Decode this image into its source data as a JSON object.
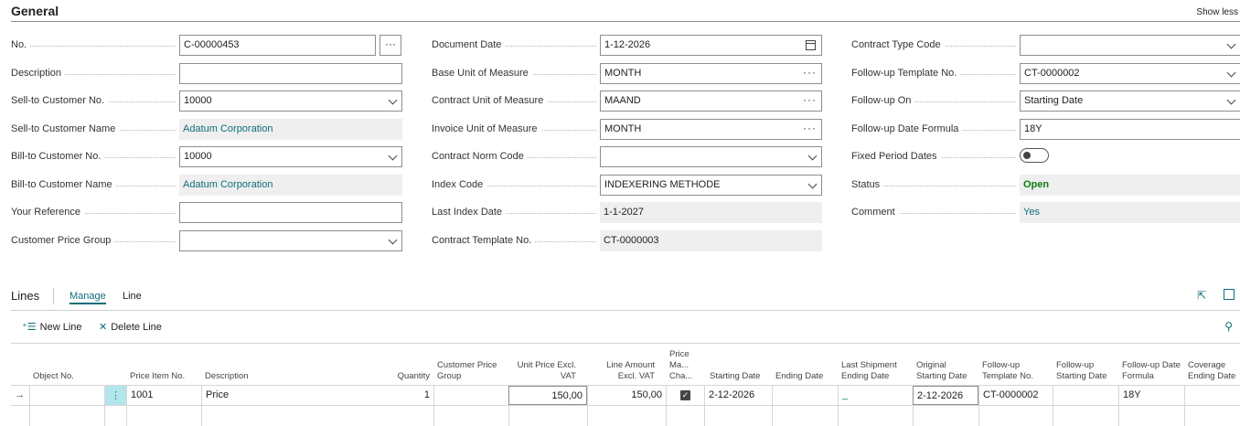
{
  "header": {
    "title": "General",
    "show_less": "Show less"
  },
  "fields": {
    "no": {
      "label": "No.",
      "value": "C-00000453"
    },
    "description": {
      "label": "Description",
      "value": ""
    },
    "sell_to_customer_no": {
      "label": "Sell-to Customer No.",
      "value": "10000"
    },
    "sell_to_customer_name": {
      "label": "Sell-to Customer Name",
      "value": "Adatum Corporation"
    },
    "bill_to_customer_no": {
      "label": "Bill-to Customer No.",
      "value": "10000"
    },
    "bill_to_customer_name": {
      "label": "Bill-to Customer Name",
      "value": "Adatum Corporation"
    },
    "your_reference": {
      "label": "Your Reference",
      "value": ""
    },
    "customer_price_group": {
      "label": "Customer Price Group",
      "value": ""
    },
    "document_date": {
      "label": "Document Date",
      "value": "1-12-2026"
    },
    "base_unit_of_measure": {
      "label": "Base Unit of Measure",
      "value": "MONTH"
    },
    "contract_unit_of_measure": {
      "label": "Contract Unit of Measure",
      "value": "MAAND"
    },
    "invoice_unit_of_measure": {
      "label": "Invoice Unit of Measure",
      "value": "MONTH"
    },
    "contract_norm_code": {
      "label": "Contract Norm Code",
      "value": ""
    },
    "index_code": {
      "label": "Index Code",
      "value": "INDEXERING METHODE"
    },
    "last_index_date": {
      "label": "Last Index Date",
      "value": "1-1-2027"
    },
    "contract_template_no": {
      "label": "Contract Template No.",
      "value": "CT-0000003"
    },
    "contract_type_code": {
      "label": "Contract Type Code",
      "value": ""
    },
    "follow_up_template_no": {
      "label": "Follow-up Template No.",
      "value": "CT-0000002"
    },
    "follow_up_on": {
      "label": "Follow-up On",
      "value": "Starting Date"
    },
    "follow_up_date_formula": {
      "label": "Follow-up Date Formula",
      "value": "18Y"
    },
    "fixed_period_dates": {
      "label": "Fixed Period Dates",
      "value": false
    },
    "status": {
      "label": "Status",
      "value": "Open"
    },
    "comment": {
      "label": "Comment",
      "value": "Yes"
    }
  },
  "lines": {
    "title": "Lines",
    "tabs": {
      "manage": "Manage",
      "line": "Line"
    },
    "actions": {
      "new_line": "New Line",
      "delete_line": "Delete Line"
    },
    "columns": {
      "object_no": "Object No.",
      "price_item_no": "Price Item No.",
      "description": "Description",
      "quantity": "Quantity",
      "customer_price_group": "Customer Price Group",
      "unit_price": "Unit Price Excl. VAT",
      "line_amount": "Line Amount Excl. VAT",
      "price_ma_cha": "Price Ma... Cha...",
      "starting_date": "Starting Date",
      "ending_date": "Ending Date",
      "last_shipment_ending_date": "Last Shipment Ending Date",
      "original_starting_date": "Original Starting Date",
      "follow_up_template_no": "Follow-up Template No.",
      "follow_up_starting_date": "Follow-up Starting Date",
      "follow_up_date_formula": "Follow-up Date Formula",
      "coverage_ending_date": "Coverage Ending Date"
    },
    "rows": [
      {
        "object_no": "",
        "price_item_no": "1001",
        "description": "Price",
        "quantity": "1",
        "customer_price_group": "",
        "unit_price": "150,00",
        "line_amount": "150,00",
        "price_ma_cha": true,
        "starting_date": "2-12-2026",
        "ending_date": "",
        "last_shipment_ending_date": "_",
        "original_starting_date": "2-12-2026",
        "follow_up_template_no": "CT-0000002",
        "follow_up_starting_date": "",
        "follow_up_date_formula": "18Y",
        "coverage_ending_date": ""
      }
    ]
  },
  "colors": {
    "accent": "#0f6e7a",
    "status_open": "#107c10"
  }
}
